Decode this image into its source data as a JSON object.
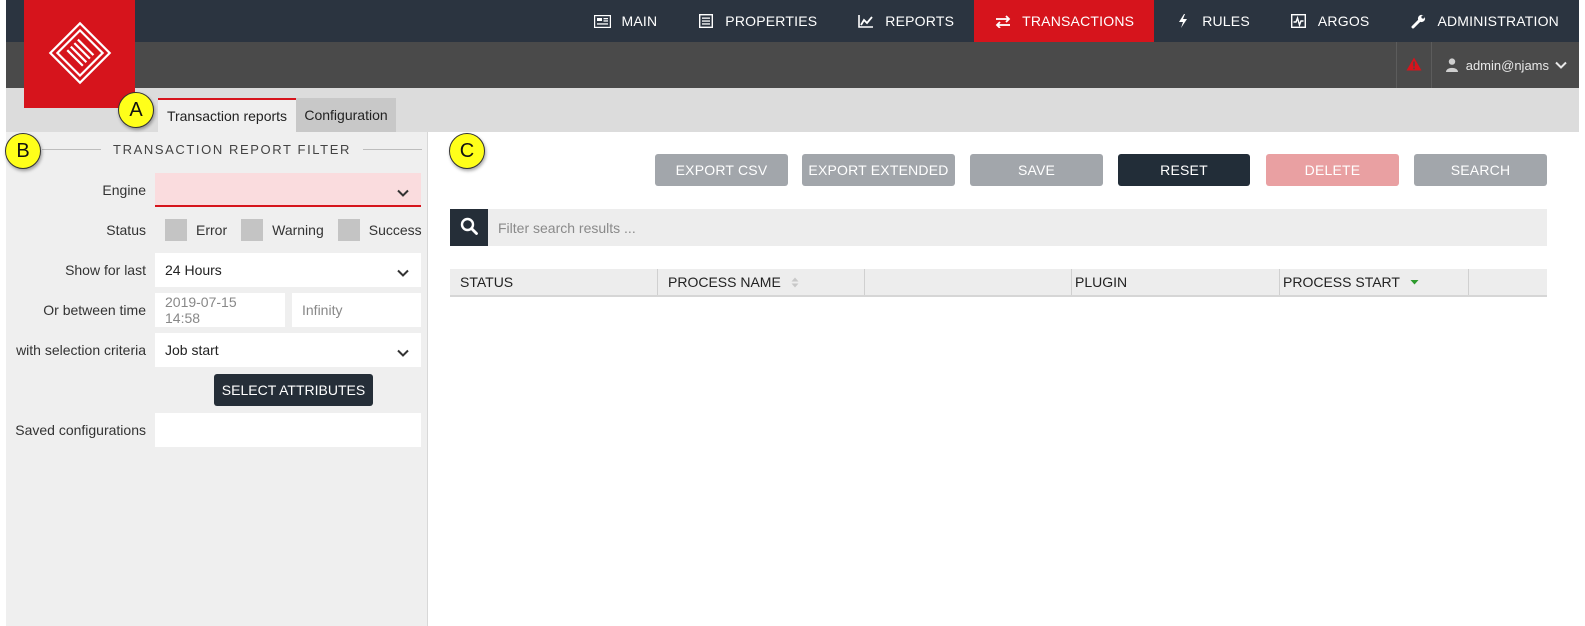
{
  "nav": {
    "items": [
      {
        "label": "MAIN",
        "icon": "newspaper-icon"
      },
      {
        "label": "PROPERTIES",
        "icon": "list-icon"
      },
      {
        "label": "REPORTS",
        "icon": "line-chart-icon"
      },
      {
        "label": "TRANSACTIONS",
        "icon": "exchange-icon"
      },
      {
        "label": "RULES",
        "icon": "bolt-icon"
      },
      {
        "label": "ARGOS",
        "icon": "monitor-chart-icon"
      },
      {
        "label": "ADMINISTRATION",
        "icon": "wrench-icon"
      }
    ],
    "active": "TRANSACTIONS"
  },
  "header": {
    "user": "admin@njams"
  },
  "tabs": [
    {
      "label": "Transaction reports"
    },
    {
      "label": "Configuration"
    }
  ],
  "markers": {
    "a": "A",
    "b": "B",
    "c": "C"
  },
  "filter": {
    "title": "TRANSACTION REPORT FILTER",
    "engine_label": "Engine",
    "engine_value": "",
    "status_label": "Status",
    "status_options": [
      "Error",
      "Warning",
      "Success"
    ],
    "show_for_last_label": "Show for last",
    "show_for_last_value": "24 Hours",
    "between_label": "Or between time",
    "between_from": "2019-07-15 14:58",
    "between_to": "Infinity",
    "criteria_label": "with selection criteria",
    "criteria_value": "Job start",
    "select_attributes_label": "SELECT ATTRIBUTES",
    "saved_label": "Saved configurations",
    "saved_value": ""
  },
  "toolbar": {
    "export_csv": "EXPORT CSV",
    "export_extended": "EXPORT EXTENDED",
    "save": "SAVE",
    "reset": "RESET",
    "delete": "DELETE",
    "search": "SEARCH"
  },
  "search": {
    "placeholder": "Filter search results ..."
  },
  "table": {
    "columns": [
      "STATUS",
      "PROCESS NAME",
      "",
      "PLUGIN",
      "PROCESS START",
      ""
    ]
  },
  "colors": {
    "accent": "#d6141c",
    "nav_bg": "#2b3440",
    "dark_button": "#222d38",
    "grey_button": "#a2a6ab",
    "delete_button": "#e9a0a2",
    "marker": "#ffff1a"
  }
}
